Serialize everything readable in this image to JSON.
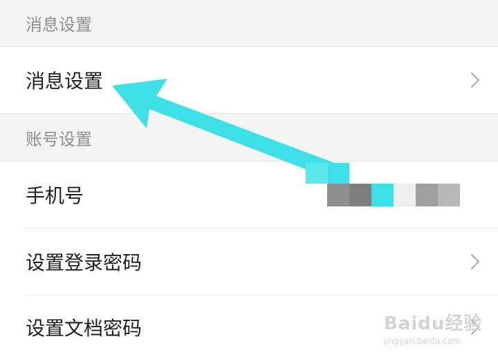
{
  "sections": [
    {
      "header": "消息设置",
      "items": [
        {
          "label": "消息设置"
        }
      ]
    },
    {
      "header": "账号设置",
      "items": [
        {
          "label": "手机号"
        },
        {
          "label": "设置登录密码"
        },
        {
          "label": "设置文档密码"
        }
      ]
    }
  ],
  "icons": {
    "chevron": "chevron-right-icon",
    "annotation": "arrow-annotation"
  },
  "colors": {
    "arrow": "#3de0e6",
    "section_bg": "#f4f4f4",
    "text": "#1f1f1f",
    "header_text": "#8e8e8e"
  },
  "watermark": {
    "brand": "Baidu经验",
    "url": "jingyan.baidu.com"
  }
}
